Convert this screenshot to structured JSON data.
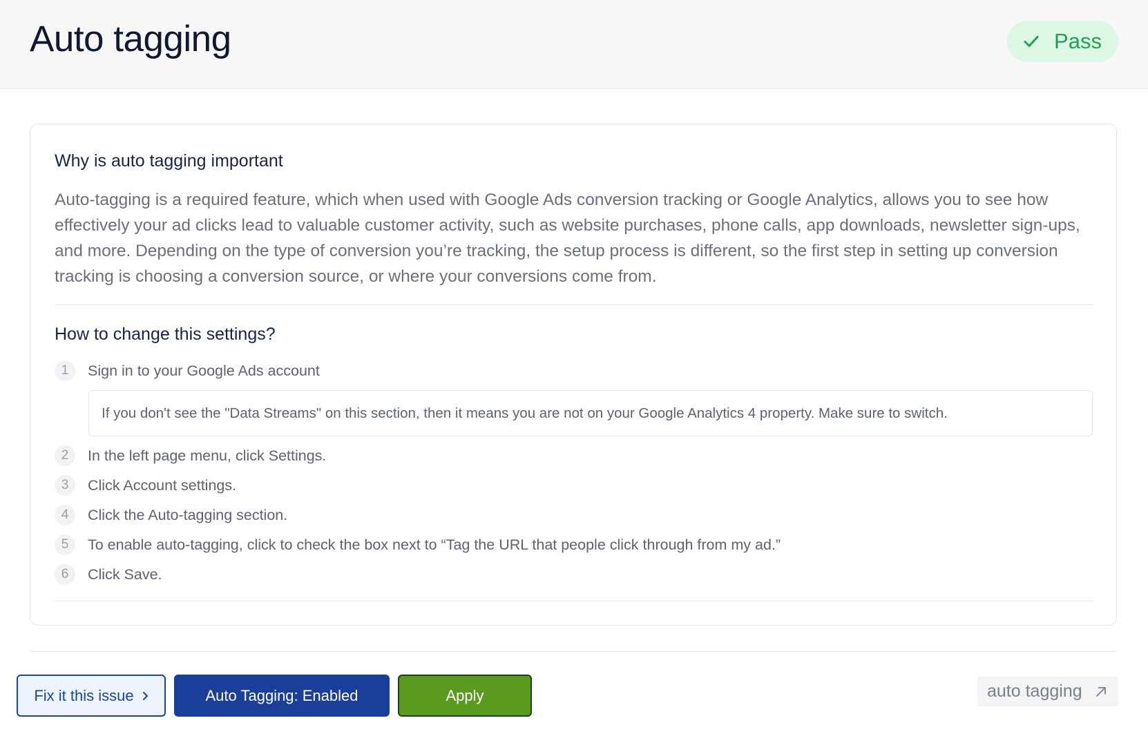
{
  "header": {
    "title": "Auto tagging",
    "status": {
      "label": "Pass",
      "icon": "check-icon",
      "color": "#1fa14f",
      "background": "#dcf7e4"
    }
  },
  "card": {
    "why": {
      "title": "Why is auto tagging important",
      "body": "Auto-tagging is a required feature, which when used with Google Ads conversion tracking or Google Analytics, allows you to see how effectively your ad clicks lead to valuable customer activity, such as website purchases, phone calls, app downloads, newsletter sign-ups, and more. Depending on the type of conversion you’re tracking, the setup process is different, so the first step in setting up conversion tracking is choosing a conversion source, or where your conversions come from."
    },
    "how": {
      "title": "How to change this settings?",
      "steps": [
        {
          "num": "1",
          "text": "Sign in to your Google Ads account"
        },
        {
          "num": "2",
          "text": "In the left page menu, click Settings."
        },
        {
          "num": "3",
          "text": "Click Account settings."
        },
        {
          "num": "4",
          "text": "Click the Auto-tagging section."
        },
        {
          "num": "5",
          "text": "To enable auto-tagging, click to check the box next to “Tag the URL that people click through from my ad.”"
        },
        {
          "num": "6",
          "text": "Click Save."
        }
      ],
      "note": "If you don't see the \"Data Streams\" on this section, then it means you are not on your Google Analytics 4 property. Make sure to switch."
    }
  },
  "footer": {
    "fix_label": "Fix it this issue",
    "fix_icon": "chevron-right-icon",
    "toggle_label": "Auto Tagging: Enabled",
    "apply_label": "Apply",
    "tag_link_label": "auto tagging",
    "tag_link_icon": "arrow-up-right-icon"
  },
  "colors": {
    "primary": "#1a3f9a",
    "apply": "#5a9b1f",
    "pass": "#1fa14f"
  }
}
